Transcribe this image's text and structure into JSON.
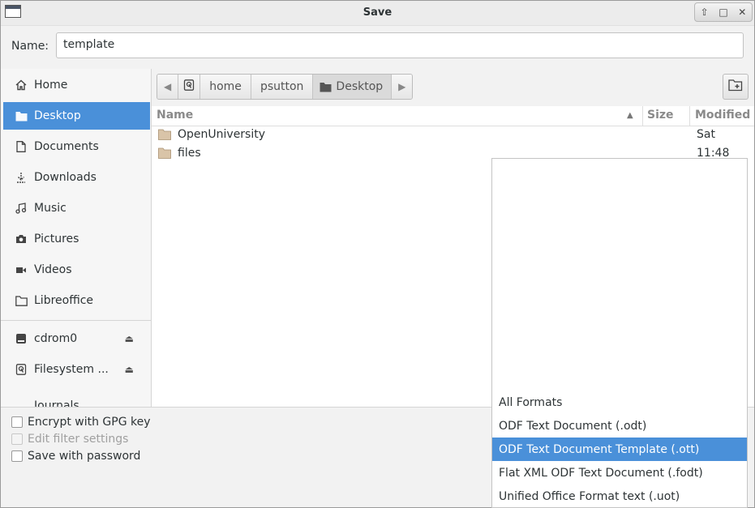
{
  "window": {
    "title": "Save"
  },
  "name_field": {
    "label": "Name:",
    "value": "template"
  },
  "sidebar": {
    "places": [
      {
        "label": "Home",
        "icon": "home-icon"
      },
      {
        "label": "Desktop",
        "icon": "desktop-folder-icon",
        "active": true
      },
      {
        "label": "Documents",
        "icon": "document-icon"
      },
      {
        "label": "Downloads",
        "icon": "download-icon"
      },
      {
        "label": "Music",
        "icon": "music-icon"
      },
      {
        "label": "Pictures",
        "icon": "camera-icon"
      },
      {
        "label": "Videos",
        "icon": "video-icon"
      },
      {
        "label": "Libreoffice",
        "icon": "folder-icon"
      }
    ],
    "devices": [
      {
        "label": "cdrom0",
        "icon": "drive-icon"
      },
      {
        "label": "Filesystem ...",
        "icon": "harddisk-icon"
      }
    ],
    "partial_item": "Journals"
  },
  "pathbar": {
    "crumbs": [
      "home",
      "psutton",
      "Desktop"
    ]
  },
  "filelist": {
    "columns": {
      "name": "Name",
      "size": "Size",
      "modified": "Modified"
    },
    "rows": [
      {
        "name": "OpenUniversity",
        "size": "",
        "modified": "Sat"
      },
      {
        "name": "files",
        "size": "",
        "modified": "11:48"
      }
    ]
  },
  "options": {
    "encrypt": "Encrypt with GPG key",
    "edit_filter": "Edit filter settings",
    "save_password": "Save with password"
  },
  "file_type_menu": {
    "items": [
      "All Formats",
      "ODF Text Document (.odt)",
      "ODF Text Document Template (.ott)",
      "Flat XML ODF Text Document (.fodt)",
      "Unified Office Format text (.uot)"
    ],
    "selected": "ODF Text Document Template (.ott)"
  },
  "colors": {
    "accent": "#4a90d9",
    "folder": "#d9c4a8"
  }
}
